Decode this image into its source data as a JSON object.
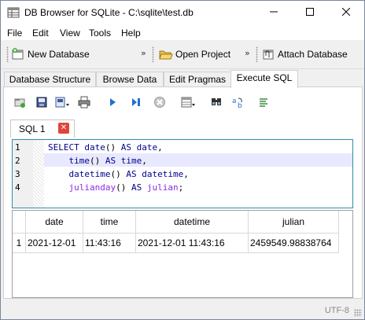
{
  "window": {
    "title": "DB Browser for SQLite - C:\\sqlite\\test.db"
  },
  "menu": [
    "File",
    "Edit",
    "View",
    "Tools",
    "Help"
  ],
  "toolbar": {
    "new_database": "New Database",
    "open_project": "Open Project",
    "attach_database": "Attach Database",
    "overflow": "»"
  },
  "tabs": [
    "Database Structure",
    "Browse Data",
    "Edit Pragmas",
    "Execute SQL"
  ],
  "active_tab": "Execute SQL",
  "sql_tab": {
    "label": "SQL 1",
    "close": "✕"
  },
  "editor": {
    "line_numbers": [
      "1",
      "2",
      "3",
      "4"
    ],
    "current_line": 2
  },
  "results": {
    "columns": [
      "date",
      "time",
      "datetime",
      "julian"
    ],
    "rows": [
      {
        "num": "1",
        "cells": [
          "2021-12-01",
          "11:43:16",
          "2021-12-01 11:43:16",
          "2459549.98838764"
        ]
      }
    ]
  },
  "status": {
    "encoding": "UTF-8"
  },
  "colors": {
    "keyword": "#00008b",
    "identifier": "#8a2be2",
    "editor_border": "#2a90a8",
    "current_line": "#e8e8ff"
  },
  "icons": [
    "database-icon",
    "minimize-icon",
    "maximize-icon",
    "close-icon",
    "new-database-icon",
    "open-project-icon",
    "attach-database-icon",
    "open-tab-icon",
    "open-file-icon",
    "save-file-icon",
    "print-icon",
    "execute-all-icon",
    "execute-current-line-icon",
    "stop-icon",
    "save-results-icon",
    "find-icon",
    "find-replace-icon",
    "comment-icon"
  ]
}
